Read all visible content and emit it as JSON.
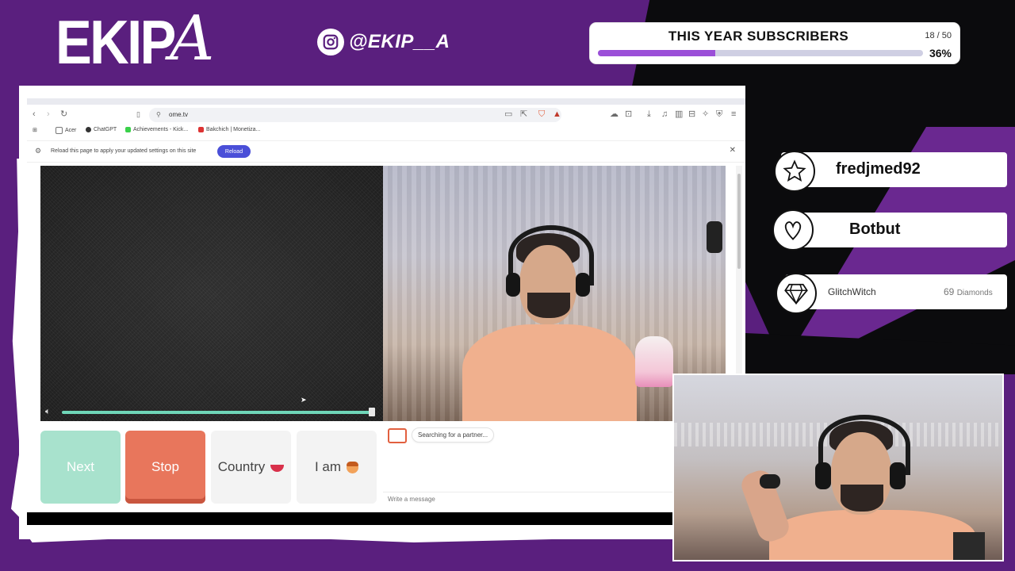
{
  "overlay": {
    "logo_main": "EKIP",
    "logo_script": "A",
    "instagram_handle": "@EKIP__A",
    "subscribers": {
      "title": "THIS YEAR SUBSCRIBERS",
      "count": "18 / 50",
      "percent_label": "36%",
      "progress": 0.36
    },
    "alerts": [
      {
        "name": "fredjmed92",
        "icon": "star-icon"
      },
      {
        "name": "Botbut",
        "icon": "heart-icon"
      },
      {
        "name": "GlitchWitch",
        "amount": "69",
        "unit": "Diamonds",
        "icon": "diamond-icon"
      }
    ],
    "colors": {
      "purple": "#5a1f7e",
      "dark": "#0b0b0d",
      "accent": "#9b4fd8"
    }
  },
  "browser": {
    "url": "ome.tv",
    "bookmarks": [
      "Acer",
      "ChatGPT",
      "Achievements - Kick...",
      "Bakchich | Monetiza..."
    ],
    "infobar_text": "Reload this page to apply your updated settings on this site",
    "reload_label": "Reload"
  },
  "app": {
    "buttons": {
      "next": "Next",
      "stop": "Stop",
      "country": "Country",
      "iam": "I am"
    },
    "chat_status": "Searching for a partner...",
    "chat_placeholder": "Write a message",
    "volume_level": 0.99,
    "colors": {
      "next": "#a8e2cd",
      "stop": "#e8765c",
      "volume": "#6fd6b8"
    }
  }
}
